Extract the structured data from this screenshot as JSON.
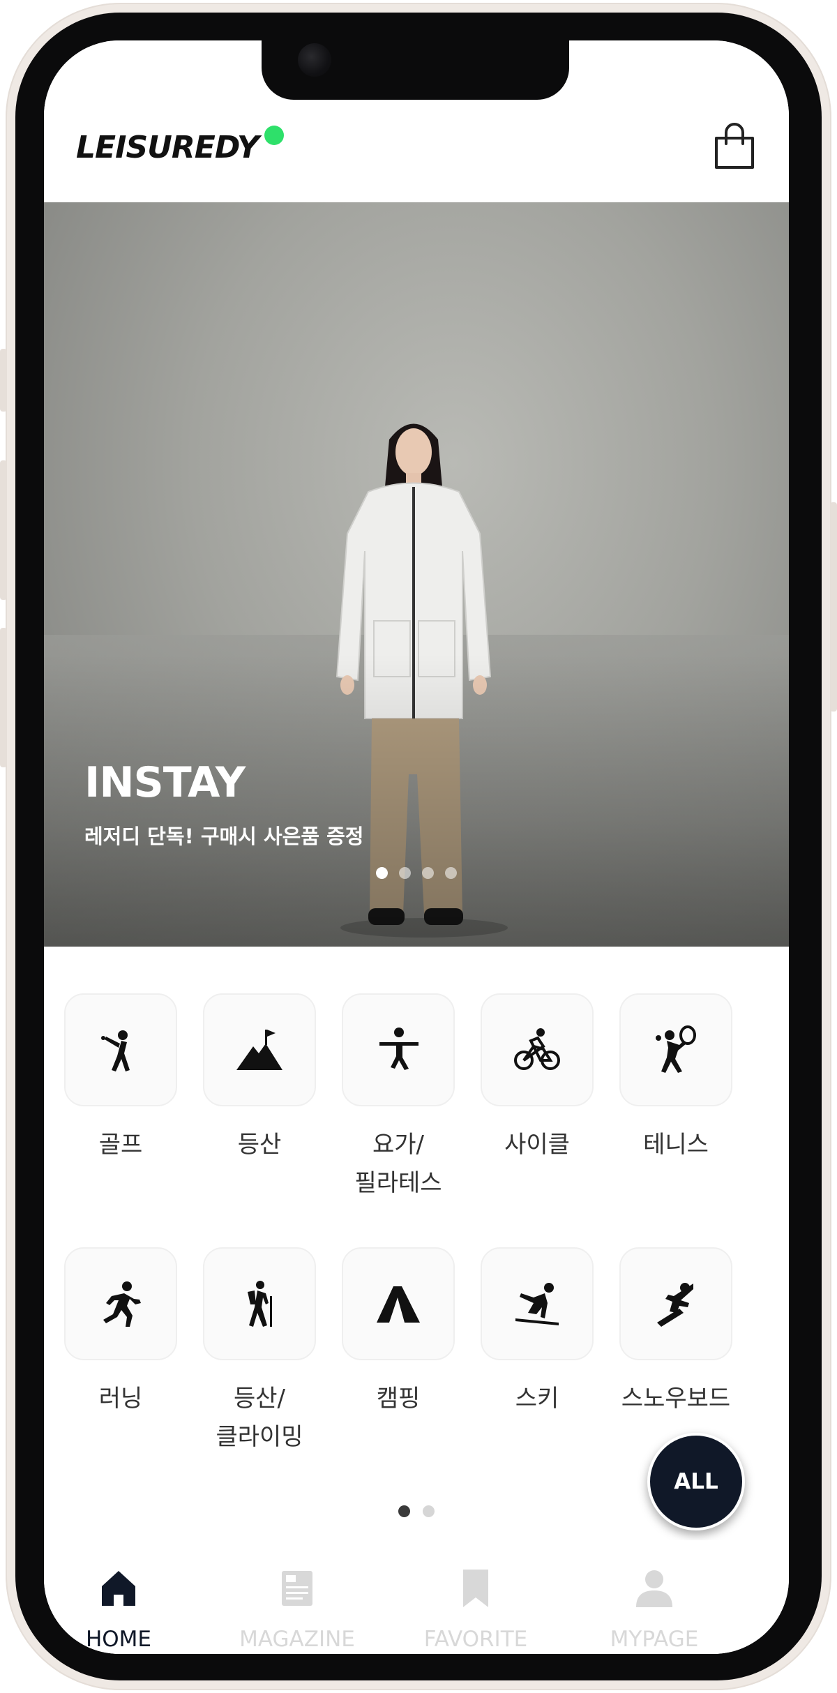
{
  "app": {
    "logo_text": "LEISUREDY",
    "accent_color": "#2ee06a",
    "dark_color": "#101828"
  },
  "header": {
    "cart_icon": "shopping-bag-icon"
  },
  "hero": {
    "title": "INSTAY",
    "subtitle": "레저디 단독! 구매시 사은품 증정",
    "slide_count": 4,
    "active_slide": 1
  },
  "categories": [
    {
      "label": "골프",
      "icon": "golf-icon"
    },
    {
      "label": "등산",
      "icon": "mountain-icon"
    },
    {
      "label": "요가/\n필라테스",
      "icon": "yoga-icon"
    },
    {
      "label": "사이클",
      "icon": "cycle-icon"
    },
    {
      "label": "테니스",
      "icon": "tennis-icon"
    },
    {
      "label": "러닝",
      "icon": "running-icon"
    },
    {
      "label": "등산/\n클라이밍",
      "icon": "hiking-icon"
    },
    {
      "label": "캠핑",
      "icon": "tent-icon"
    },
    {
      "label": "스키",
      "icon": "ski-icon"
    },
    {
      "label": "스노우보드",
      "icon": "snowboard-icon"
    }
  ],
  "category_pages": {
    "count": 2,
    "active": 1
  },
  "all_button": {
    "label": "ALL"
  },
  "tabbar": {
    "tabs": [
      {
        "label": "HOME",
        "icon": "home-icon",
        "active": true
      },
      {
        "label": "MAGAZINE",
        "icon": "magazine-icon",
        "active": false
      },
      {
        "label": "FAVORITE",
        "icon": "bookmark-icon",
        "active": false
      },
      {
        "label": "MYPAGE",
        "icon": "user-icon",
        "active": false
      }
    ]
  }
}
